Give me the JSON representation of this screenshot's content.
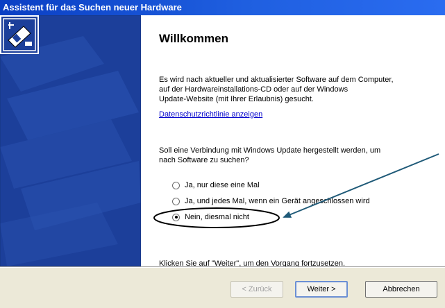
{
  "window": {
    "title": "Assistent für das Suchen neuer Hardware"
  },
  "content": {
    "heading": "Willkommen",
    "intro": [
      "Es wird nach aktueller und aktualisierter Software auf dem Computer,",
      "auf der Hardwareinstallations-CD oder auf der Windows",
      "Update-Website (mit Ihrer Erlaubnis) gesucht."
    ],
    "privacy_link": "Datenschutzrichtlinie anzeigen",
    "question": [
      "Soll eine Verbindung mit Windows Update hergestellt werden, um",
      "nach Software zu suchen?"
    ],
    "options": [
      {
        "label": "Ja, nur diese eine Mal",
        "checked": false
      },
      {
        "label": "Ja, und jedes Mal, wenn ein Gerät angeschlossen wird",
        "checked": false
      },
      {
        "label": "Nein, diesmal nicht",
        "checked": true
      }
    ],
    "footer": "Klicken Sie auf \"Weiter\", um den Vorgang fortzusetzen."
  },
  "buttons": {
    "back": "< Zurück",
    "next": "Weiter >",
    "cancel": "Abbrechen"
  },
  "colors": {
    "titlebar": "#0a3fc4",
    "left_panel": "#1c3f9a",
    "annotation": "#1f5a78",
    "button_bar": "#ece9d8"
  }
}
